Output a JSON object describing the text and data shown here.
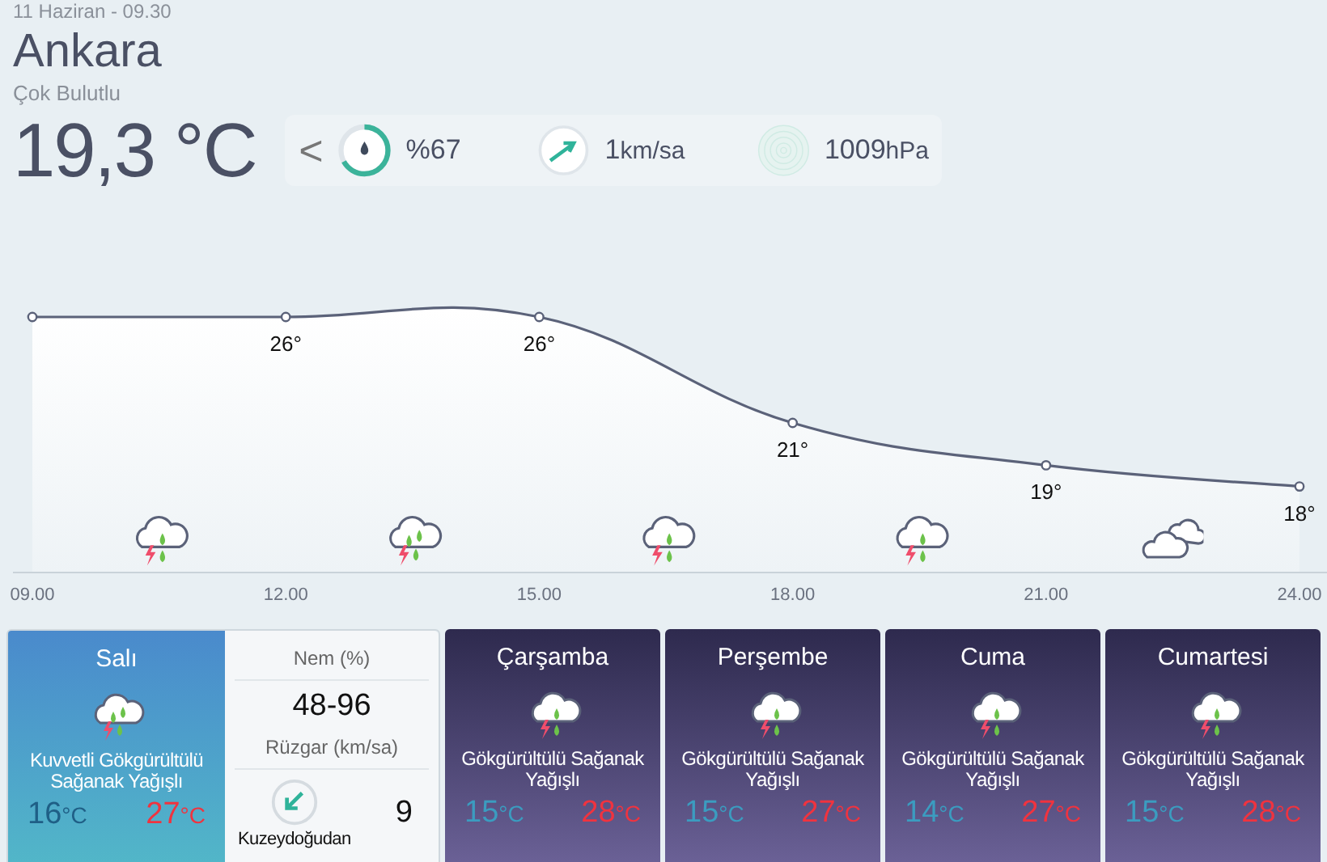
{
  "header": {
    "datetime": "11 Haziran - 09.30",
    "city": "Ankara",
    "condition": "Çok Bulutlu",
    "temperature": "19,3 °C"
  },
  "stats": {
    "prev": "<",
    "humidity": {
      "text": "%67",
      "level": 0.67
    },
    "wind": {
      "value": "1",
      "unit": "km/sa"
    },
    "pressure": {
      "value": "1009",
      "unit": "hPa"
    }
  },
  "hourly": {
    "points": [
      {
        "time": "09.00"
      },
      {
        "time": "12.00",
        "label": "26°"
      },
      {
        "time": "15.00",
        "label": "26°"
      },
      {
        "time": "18.00",
        "label": "21°"
      },
      {
        "time": "21.00",
        "label": "19°"
      },
      {
        "time": "24.00",
        "label": "18°"
      }
    ],
    "icons": [
      {
        "kind": "storm"
      },
      {
        "kind": "heavy-storm"
      },
      {
        "kind": "storm"
      },
      {
        "kind": "storm"
      },
      {
        "kind": "cloudy"
      }
    ]
  },
  "days": [
    {
      "name": "Salı",
      "selected": true,
      "condition": "Kuvvetli Gökgürültülü Sağanak Yağışlı",
      "kind": "heavy-storm",
      "low": {
        "value": "16",
        "unit": "°C"
      },
      "high": {
        "value": "27",
        "unit": "°C"
      },
      "details": {
        "humidity_label": "Nem (%)",
        "humidity": "48-96",
        "wind_label": "Rüzgar (km/sa)",
        "wind_direction": "Kuzeydoğudan",
        "wind_speed": "9"
      }
    },
    {
      "name": "Çarşamba",
      "selected": false,
      "condition": "Gökgürültülü Sağanak Yağışlı",
      "kind": "storm",
      "low": {
        "value": "15",
        "unit": "°C"
      },
      "high": {
        "value": "28",
        "unit": "°C"
      }
    },
    {
      "name": "Perşembe",
      "selected": false,
      "condition": "Gökgürültülü Sağanak Yağışlı",
      "kind": "storm",
      "low": {
        "value": "15",
        "unit": "°C"
      },
      "high": {
        "value": "27",
        "unit": "°C"
      }
    },
    {
      "name": "Cuma",
      "selected": false,
      "condition": "Gökgürültülü Sağanak Yağışlı",
      "kind": "storm",
      "low": {
        "value": "14",
        "unit": "°C"
      },
      "high": {
        "value": "27",
        "unit": "°C"
      }
    },
    {
      "name": "Cumartesi",
      "selected": false,
      "condition": "Gökgürültülü Sağanak Yağışlı",
      "kind": "storm",
      "low": {
        "value": "15",
        "unit": "°C"
      },
      "high": {
        "value": "28",
        "unit": "°C"
      }
    }
  ]
}
